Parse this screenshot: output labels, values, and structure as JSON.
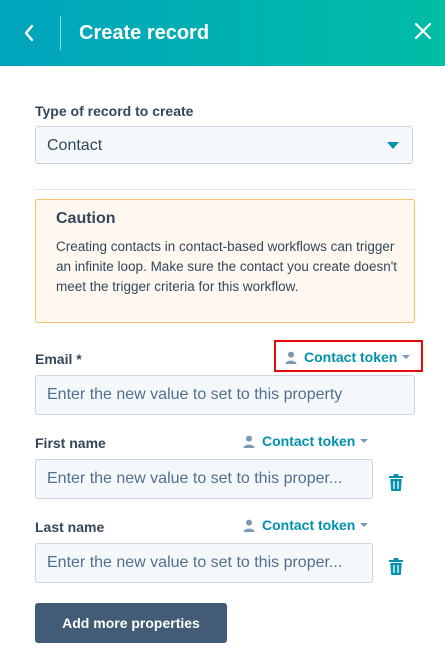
{
  "header": {
    "title": "Create record",
    "back_icon": "chevron-left-icon",
    "close_icon": "close-icon",
    "background": "#00a4bd"
  },
  "record_type": {
    "label": "Type of record to create",
    "selected": "Contact"
  },
  "caution": {
    "title": "Caution",
    "body": "Creating contacts in contact-based workflows can trigger an infinite loop. Make sure the contact you create doesn't meet the trigger criteria for this workflow."
  },
  "fields": [
    {
      "label": "Email *",
      "token_label": "Contact token",
      "placeholder": "Enter the new value to set to this property"
    },
    {
      "label": "First name",
      "token_label": "Contact token",
      "placeholder": "Enter the new value to set to this proper..."
    },
    {
      "label": "Last name",
      "token_label": "Contact token",
      "placeholder": "Enter the new value to set to this proper..."
    }
  ],
  "add_button": {
    "label": "Add more properties",
    "background": "#425b76"
  },
  "colors": {
    "accent": "#0091ae",
    "text": "#33475b",
    "highlight": "#e60a0a",
    "delete": "#0091ae"
  }
}
